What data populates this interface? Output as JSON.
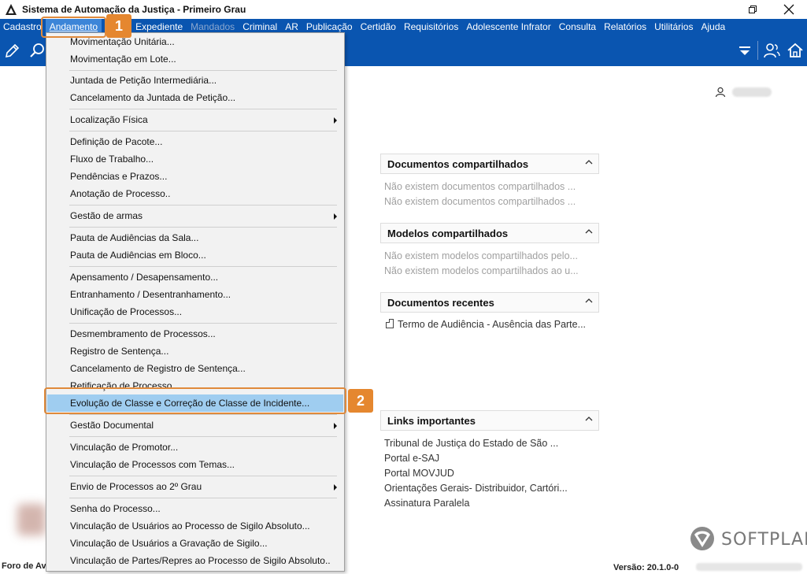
{
  "window": {
    "title": "Sistema de Automação da Justiça - Primeiro Grau"
  },
  "menubar": {
    "items": [
      {
        "label": "Cadastro",
        "state": "normal"
      },
      {
        "label": "Andamento",
        "state": "active"
      },
      {
        "label": "Expediente",
        "state": "normal"
      },
      {
        "label": "Mandados",
        "state": "disabled"
      },
      {
        "label": "Criminal",
        "state": "normal"
      },
      {
        "label": "AR",
        "state": "normal"
      },
      {
        "label": "Publicação",
        "state": "normal"
      },
      {
        "label": "Certidão",
        "state": "normal"
      },
      {
        "label": "Requisitórios",
        "state": "normal"
      },
      {
        "label": "Adolescente Infrator",
        "state": "normal"
      },
      {
        "label": "Consulta",
        "state": "normal"
      },
      {
        "label": "Relatórios",
        "state": "normal"
      },
      {
        "label": "Utilitários",
        "state": "normal"
      },
      {
        "label": "Ajuda",
        "state": "normal"
      }
    ]
  },
  "dropdown": {
    "items": [
      "Movimentação Unitária...",
      "Movimentação em Lote...",
      "Juntada de Petição Intermediária...",
      "Cancelamento da Juntada de Petição...",
      "Localização Física",
      "Definição de Pacote...",
      "Fluxo de Trabalho...",
      "Pendências e Prazos...",
      "Anotação de Processo..",
      "Gestão de armas",
      "Pauta de Audiências da Sala...",
      "Pauta de Audiências em Bloco...",
      "Apensamento / Desapensamento...",
      "Entranhamento / Desentranhamento...",
      "Unificação de Processos...",
      "Desmembramento de Processos...",
      "Registro de Sentença...",
      "Cancelamento de Registro de Sentença...",
      "Retificação de Processo...",
      "Evolução de Classe e Correção de Classe de Incidente...",
      "Gestão Documental",
      "Vinculação de Promotor...",
      "Vinculação de Processos com Temas...",
      "Envio de Processos ao 2º Grau",
      "Senha do Processo...",
      "Vinculação de Usuários ao Processo de Sigilo Absoluto...",
      "Vinculação de Usuários a Gravação de Sigilo...",
      "Vinculação de Partes/Repres ao Processo de Sigilo Absoluto.."
    ]
  },
  "callouts": {
    "one": "1",
    "two": "2"
  },
  "panels": {
    "docs_shared": {
      "title": "Documentos compartilhados",
      "lines": [
        "Não existem documentos compartilhados ...",
        "Não existem documentos compartilhados ..."
      ]
    },
    "models_shared": {
      "title": "Modelos compartilhados",
      "lines": [
        "Não existem modelos compartilhados pelo...",
        "Não existem modelos compartilhados ao u..."
      ]
    },
    "recent_docs": {
      "title": "Documentos recentes",
      "lines": [
        "Termo de Audiência - Ausência das Parte..."
      ]
    },
    "links": {
      "title": "Links importantes",
      "lines": [
        "Tribunal de Justiça do Estado de São ...",
        "Portal e-SAJ",
        "Portal MOVJUD",
        "Orientações Gerais- Distribuidor, Cartóri...",
        "Assinatura Paralela"
      ]
    }
  },
  "statusbar": {
    "foro": "Foro de Av",
    "versao": "Versão: 20.1.0-0"
  },
  "brand": {
    "name": "SOFTPLAN"
  },
  "colors": {
    "menubar_bg": "#0a55b0",
    "highlight": "#9fcdf0",
    "callout": "#e5872f"
  }
}
